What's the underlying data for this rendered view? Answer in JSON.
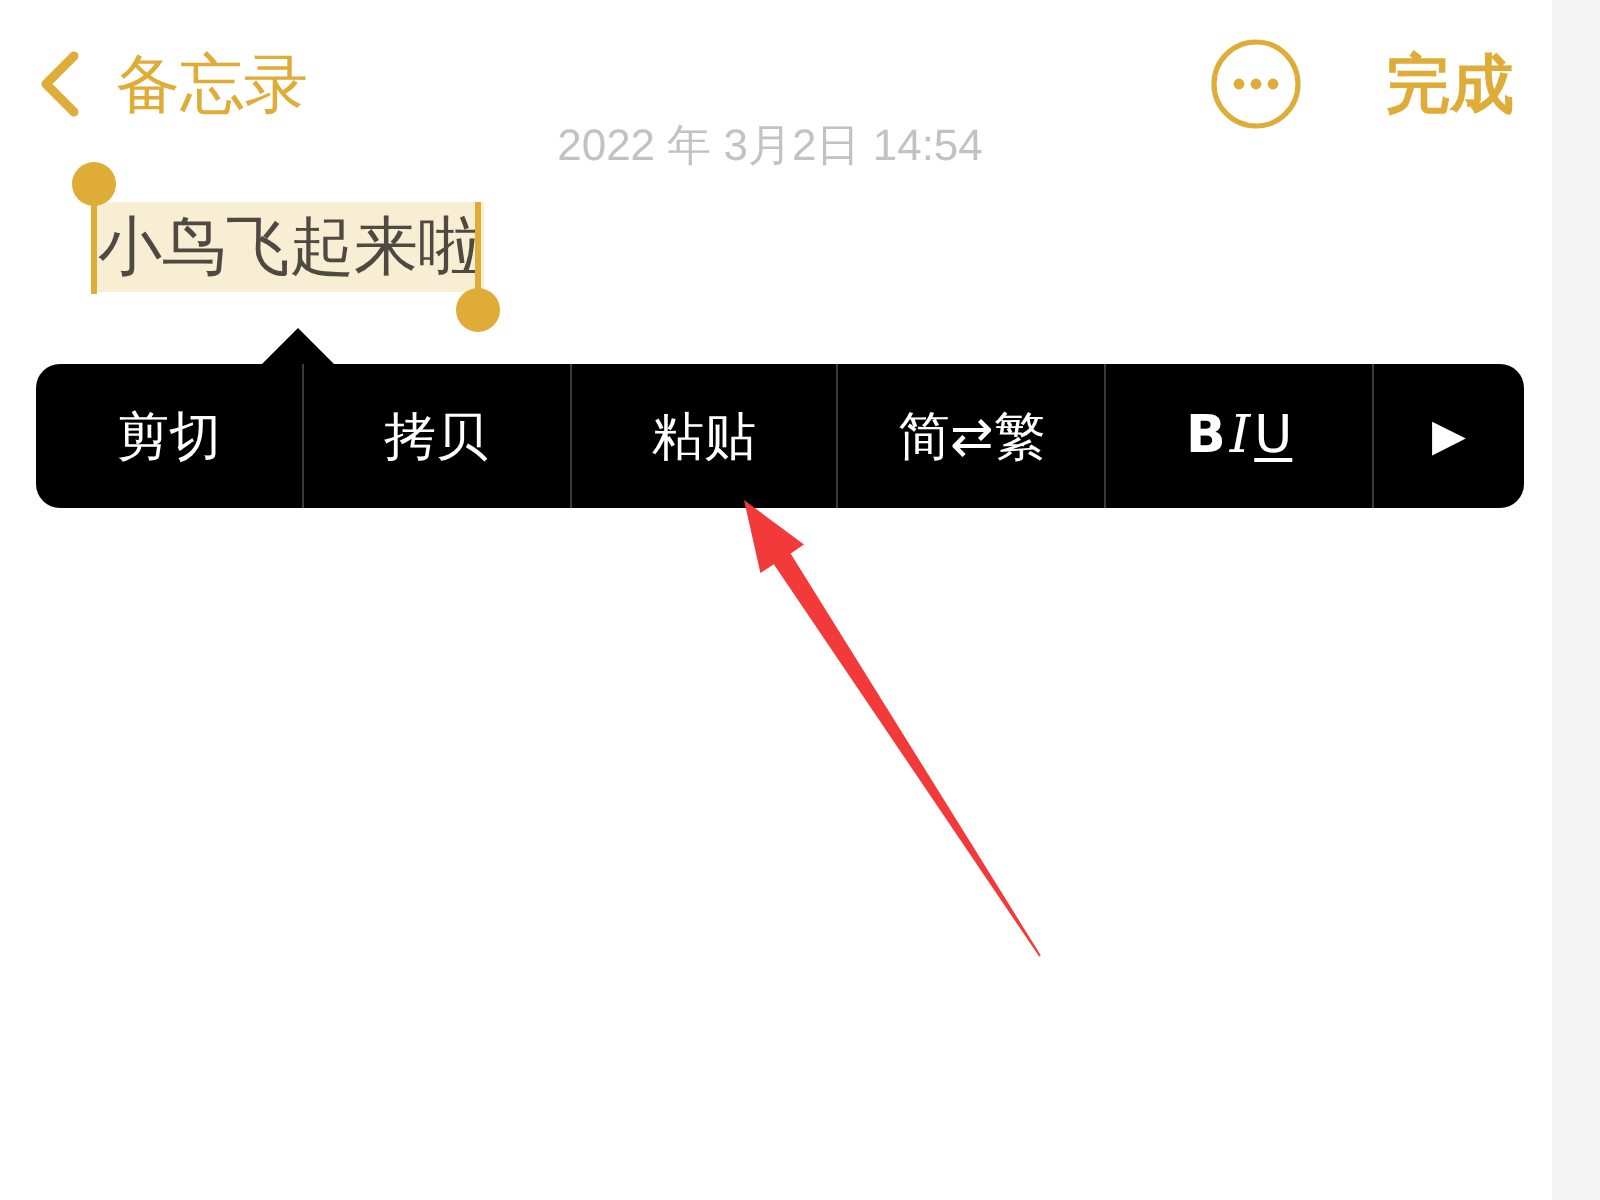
{
  "nav": {
    "back_label": "备忘录",
    "done_label": "完成"
  },
  "note": {
    "timestamp": "2022 年 3月2日 14:54",
    "text": "小鸟飞起来啦",
    "selected": true
  },
  "context_menu": {
    "items": [
      {
        "kind": "text",
        "label": "剪切"
      },
      {
        "kind": "text",
        "label": "拷贝"
      },
      {
        "kind": "text",
        "label": "粘贴"
      },
      {
        "kind": "text",
        "label": "简⇄繁"
      },
      {
        "kind": "format",
        "letters": [
          "B",
          "I",
          "U"
        ]
      },
      {
        "kind": "more",
        "label": "▶"
      }
    ]
  },
  "annotation": {
    "kind": "arrow"
  }
}
